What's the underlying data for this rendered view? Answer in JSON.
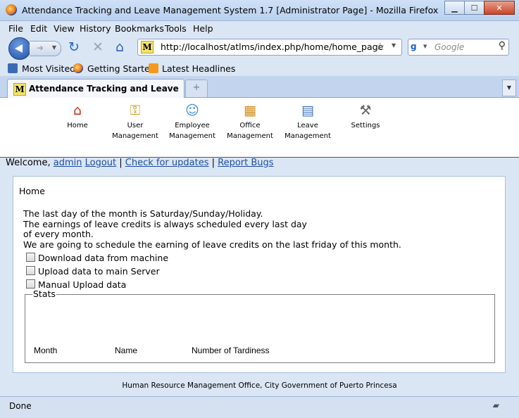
{
  "window": {
    "title": "Attendance Tracking and Leave Management System 1.7 [Administrator Page] - Mozilla Firefox",
    "min": "▁",
    "max": "☐",
    "close": "✕"
  },
  "menu": {
    "file": "File",
    "edit": "Edit",
    "view": "View",
    "history": "History",
    "bookmarks": "Bookmarks",
    "tools": "Tools",
    "help": "Help"
  },
  "nav": {
    "url": "http://localhost/atlms/index.php/home/home_page",
    "search_placeholder": "Google",
    "site_icon": "M"
  },
  "bookmarks": {
    "items": [
      "Most Visited",
      "Getting Started",
      "Latest Headlines"
    ]
  },
  "tabs": {
    "active": "Attendance Tracking and Leave Man...",
    "new_tab": "+"
  },
  "toolbar": {
    "home": "Home",
    "user_1": "User",
    "user_2": "Management",
    "employee_1": "Employee",
    "employee_2": "Management",
    "office_1": "Office",
    "office_2": "Management",
    "leave_1": "Leave",
    "leave_2": "Management",
    "settings": "Settings"
  },
  "welcome": {
    "prefix": "Welcome, ",
    "user": "admin",
    "logout": "Logout",
    "sep1": " | ",
    "updates": "Check for updates",
    "sep2": " | ",
    "bugs": "Report Bugs"
  },
  "main": {
    "crumb": "Home",
    "line1": "The last day of the month is Saturday/Sunday/Holiday.",
    "line2": "The earnings of leave credits is always scheduled every last day",
    "line3": "of every month.",
    "line4": "We are going to schedule the earning of leave credits on the last friday of this month.",
    "check1": "Download data from machine",
    "check2": "Upload data to main Server",
    "check3": "Manual Upload data",
    "stats_legend": "Stats",
    "col_month": "Month",
    "col_name": "Name",
    "col_tardiness": "Number of Tardiness"
  },
  "footer": "Human Resource Management Office, City Government of Puerto Princesa",
  "status": "Done"
}
